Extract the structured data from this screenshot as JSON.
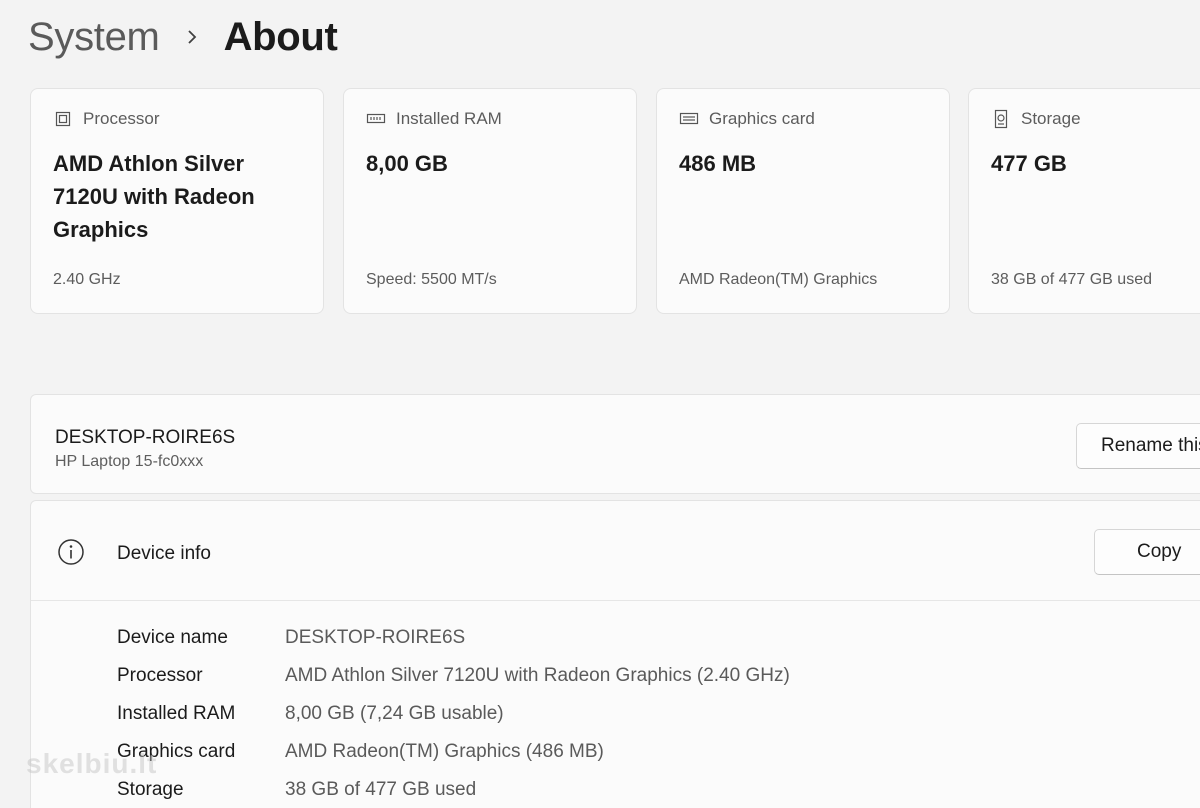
{
  "breadcrumb": {
    "parent": "System",
    "current": "About"
  },
  "cards": [
    {
      "icon": "processor-icon",
      "label": "Processor",
      "value": "AMD Athlon Silver 7120U with Radeon Graphics",
      "sub": "2.40 GHz"
    },
    {
      "icon": "ram-icon",
      "label": "Installed RAM",
      "value": "8,00 GB",
      "sub": "Speed: 5500 MT/s"
    },
    {
      "icon": "graphics-card-icon",
      "label": "Graphics card",
      "value": "486 MB",
      "sub": "AMD Radeon(TM) Graphics"
    },
    {
      "icon": "storage-icon",
      "label": "Storage",
      "value": "477 GB",
      "sub": "38 GB of 477 GB used"
    }
  ],
  "device": {
    "name": "DESKTOP-ROIRE6S",
    "model": "HP Laptop 15-fc0xxx",
    "rename_label": "Rename this PC"
  },
  "device_info": {
    "title": "Device info",
    "copy_label": "Copy",
    "specs": [
      {
        "key": "Device name",
        "value": "DESKTOP-ROIRE6S"
      },
      {
        "key": "Processor",
        "value": "AMD Athlon Silver 7120U with Radeon Graphics (2.40 GHz)"
      },
      {
        "key": "Installed RAM",
        "value": "8,00 GB (7,24 GB usable)"
      },
      {
        "key": "Graphics card",
        "value": "AMD Radeon(TM) Graphics (486 MB)"
      },
      {
        "key": "Storage",
        "value": "38 GB of 477 GB used"
      }
    ]
  },
  "watermark": "skelbiu.lt"
}
